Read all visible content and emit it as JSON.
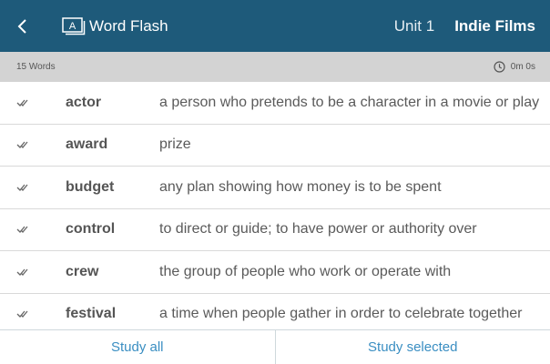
{
  "header": {
    "title": "Word Flash",
    "unit_label": "Unit 1",
    "unit_name": "Indie Films"
  },
  "subbar": {
    "word_count": "15 Words",
    "timer": "0m 0s"
  },
  "words": [
    {
      "term": "actor",
      "definition": "a person who pretends to be a character in a movie or play"
    },
    {
      "term": "award",
      "definition": "prize"
    },
    {
      "term": "budget",
      "definition": "any plan showing how money is to be spent"
    },
    {
      "term": "control",
      "definition": "to direct or guide; to have power or authority over"
    },
    {
      "term": "crew",
      "definition": "the group of people who work or operate with"
    },
    {
      "term": "festival",
      "definition": "a time when people gather in order to celebrate together"
    }
  ],
  "footer": {
    "study_all": "Study all",
    "study_selected": "Study selected"
  },
  "colors": {
    "header_bg": "#1e5a7a",
    "subbar_bg": "#d3d3d3",
    "accent": "#3a8ec2"
  }
}
